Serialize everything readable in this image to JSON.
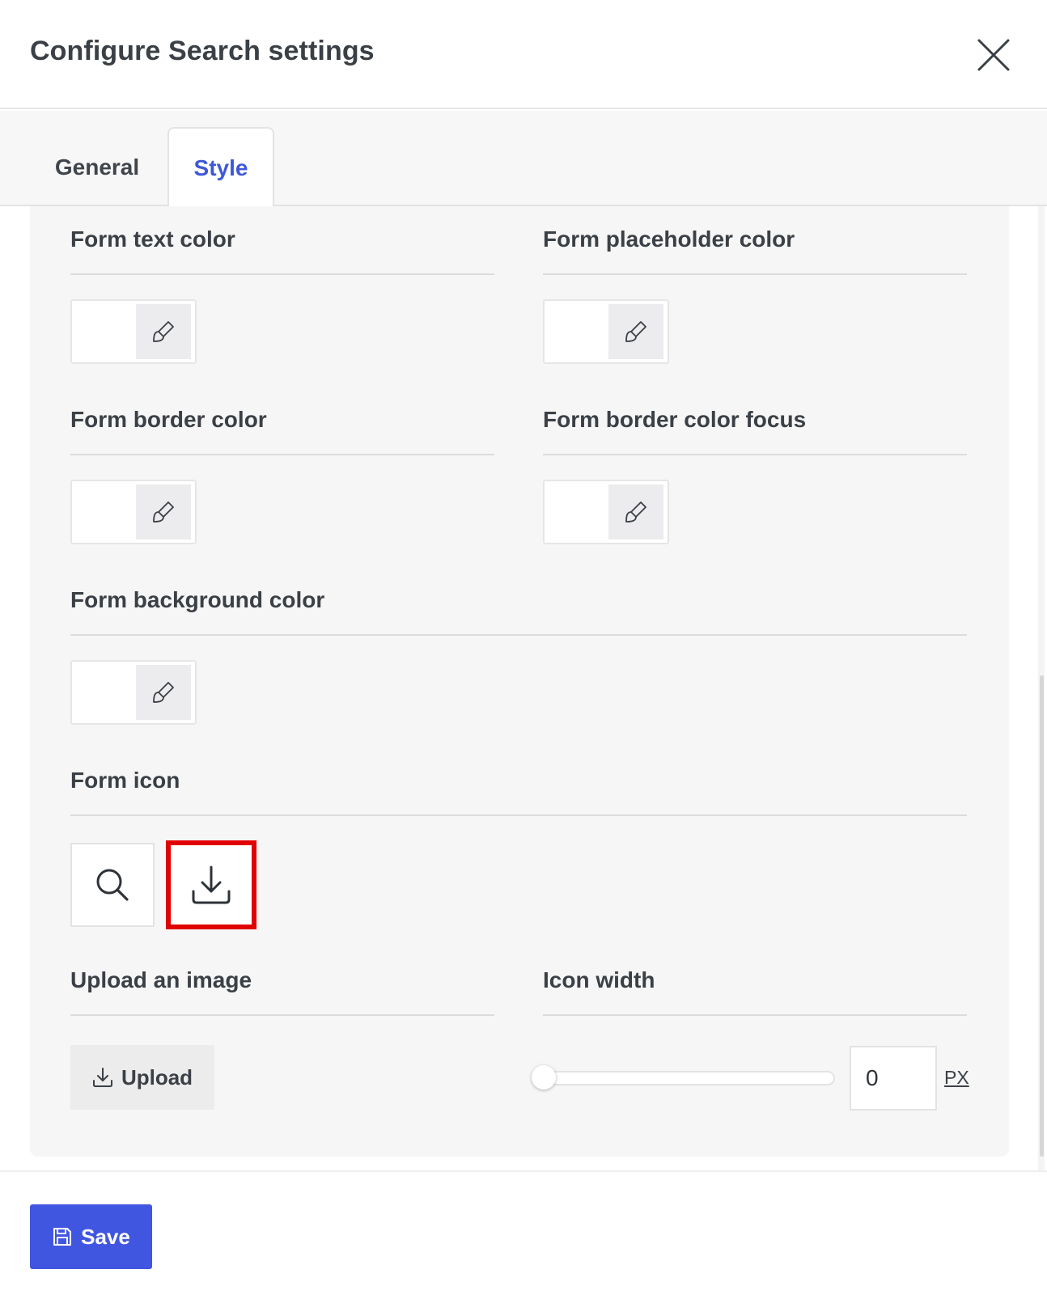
{
  "dialog": {
    "title": "Configure Search settings",
    "close_icon": "close-icon"
  },
  "tabs": [
    {
      "label": "General",
      "active": false
    },
    {
      "label": "Style",
      "active": true
    }
  ],
  "colors": {
    "accent": "#3f58d8",
    "save_button": "#4156e0",
    "selected_outline": "#e00000",
    "panel_background": "#f6f6f6"
  },
  "fields": {
    "form_text_color": {
      "label": "Form text color",
      "icon": "brush-icon"
    },
    "form_placeholder_color": {
      "label": "Form placeholder color",
      "icon": "brush-icon"
    },
    "form_border_color": {
      "label": "Form border color",
      "icon": "brush-icon"
    },
    "form_border_color_focus": {
      "label": "Form border color focus",
      "icon": "brush-icon"
    },
    "form_background_color": {
      "label": "Form background color",
      "icon": "brush-icon"
    },
    "form_icon": {
      "label": "Form icon",
      "options": [
        {
          "icon": "search-icon",
          "selected": false
        },
        {
          "icon": "download-icon",
          "selected": true
        }
      ]
    },
    "upload_image": {
      "label": "Upload an image",
      "button_label": "Upload",
      "icon": "upload-icon"
    },
    "icon_width": {
      "label": "Icon width",
      "value": "0",
      "slider_value": 0,
      "unit": "PX"
    }
  },
  "footer": {
    "save_label": "Save",
    "save_icon": "floppy-disk-icon"
  }
}
